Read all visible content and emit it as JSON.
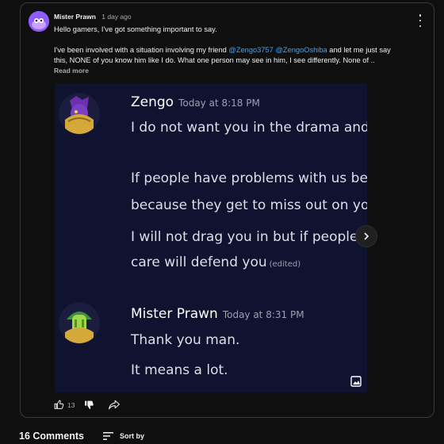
{
  "post": {
    "author": "Mister Prawn",
    "time": "1 day ago",
    "line1": "Hello gamers, I've got something important to say.",
    "line2_prefix": "I've been involved with a situation involving my friend ",
    "mention1": "@Zengo3757",
    "mention2": "@ZengoOshiba",
    "line2_suffix": " and let me just say this, NONE of you know him like I do. What one person may see in him, I see differently. None of ..",
    "read_more": "Read more"
  },
  "image": {
    "msg1": {
      "name": "Zengo",
      "time": "Today at 8:18 PM",
      "lines": [
        "I do not want you in the drama and shit rel",
        "If people have problems with us being frien",
        "because they get to miss out on your frien",
        "I will not drag you in but if people attack",
        "care will defend you"
      ],
      "edited": "(edited)"
    },
    "msg2": {
      "name": "Mister Prawn",
      "time": "Today at 8:31 PM",
      "lines": [
        "Thank you man.",
        "It means a lot."
      ]
    }
  },
  "actions": {
    "likes": "13"
  },
  "comments": {
    "title": "16 Comments",
    "sort_label": "Sort by"
  },
  "icons": {
    "menu": "more-vert-icon",
    "like": "thumbs-up-icon",
    "dislike": "thumbs-down-icon",
    "share": "share-icon",
    "next": "chevron-right-icon",
    "gallery": "image-gallery-icon",
    "sort": "sort-icon"
  },
  "colors": {
    "mention": "#3ea6ff",
    "background": "#0f0f0f",
    "image_bg": "#101330",
    "avatar": "#8f5cff"
  }
}
